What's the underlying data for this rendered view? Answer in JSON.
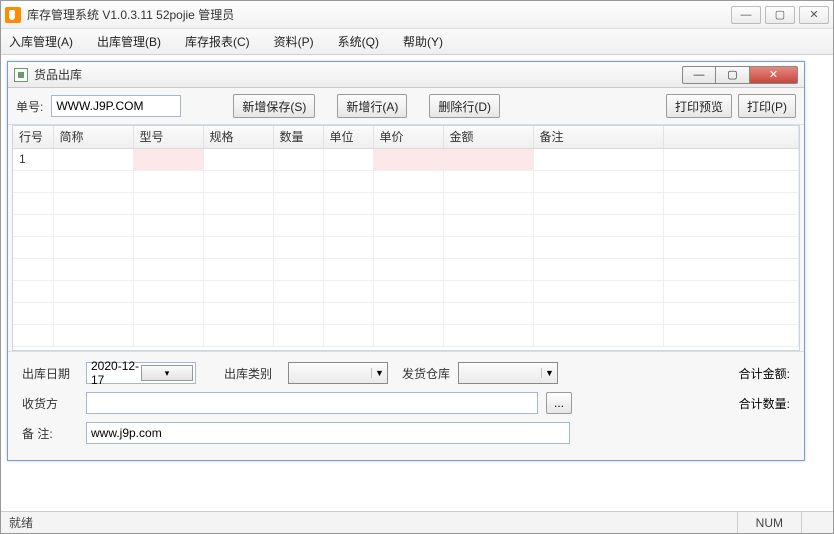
{
  "outerWindow": {
    "title": "库存管理系统 V1.0.3.11   52pojie 管理员"
  },
  "menu": {
    "items": [
      {
        "label": "入库管理(A)"
      },
      {
        "label": "出库管理(B)"
      },
      {
        "label": "库存报表(C)"
      },
      {
        "label": "资料(P)"
      },
      {
        "label": "系统(Q)"
      },
      {
        "label": "帮助(Y)"
      }
    ]
  },
  "innerWindow": {
    "title": "货品出库"
  },
  "toolbar": {
    "doc_no_label": "单号:",
    "doc_no_value": "WWW.J9P.COM",
    "new_save_label": "新增保存(S)",
    "new_row_label": "新增行(A)",
    "del_row_label": "删除行(D)",
    "print_preview_label": "打印预览",
    "print_label": "打印(P)"
  },
  "table": {
    "headers": [
      "行号",
      "简称",
      "型号",
      "规格",
      "数量",
      "单位",
      "单价",
      "金额",
      "备注",
      ""
    ],
    "rows": [
      {
        "row_no": "1",
        "name": "",
        "model": "",
        "spec": "",
        "qty": "",
        "unit": "",
        "price": "",
        "amount": "",
        "remark": ""
      }
    ]
  },
  "form": {
    "out_date_label": "出库日期",
    "out_date_value": "2020-12-17",
    "out_type_label": "出库类别",
    "out_type_value": "",
    "ship_wh_label": "发货仓库",
    "ship_wh_value": "",
    "receiver_label": "收货方",
    "receiver_value": "",
    "remark_label": "备    注:",
    "remark_value": "www.j9p.com",
    "total_amount_label": "合计金额:",
    "total_qty_label": "合计数量:"
  },
  "status": {
    "ready": "就绪",
    "num": "NUM"
  }
}
